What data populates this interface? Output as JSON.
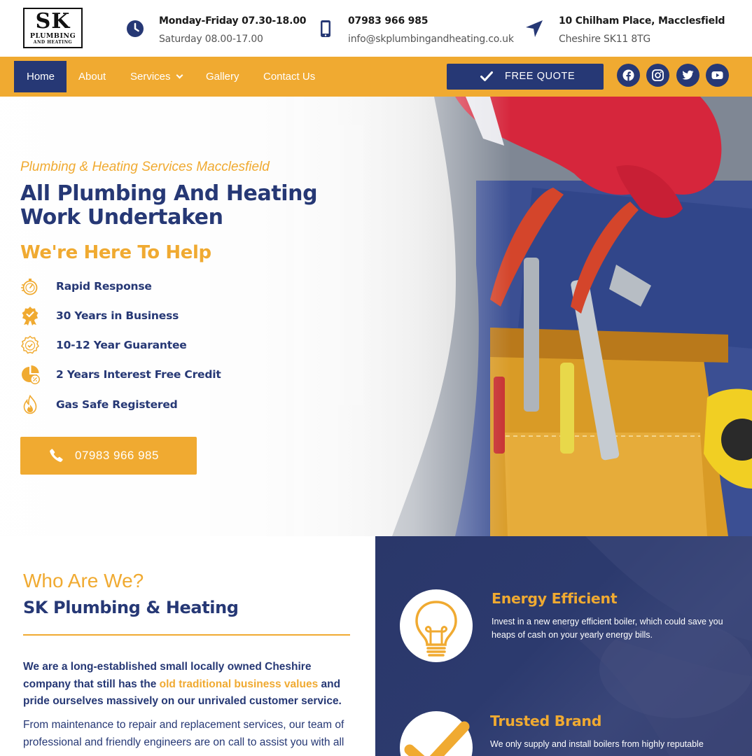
{
  "logo": {
    "mark": "SK",
    "line1": "PLUMBING",
    "line2": "AND HEATING"
  },
  "header": {
    "hours": {
      "line1": "Monday-Friday 07.30-18.00",
      "line2": "Saturday 08.00-17.00",
      "icon": "clock-icon"
    },
    "contact": {
      "line1": "07983 966 985",
      "line2": "info@skplumbingandheating.co.uk",
      "icon": "mobile-phone-icon"
    },
    "address": {
      "line1": "10 Chilham Place, Macclesfield",
      "line2": "Cheshire SK11 8TG",
      "icon": "location-arrow-icon"
    }
  },
  "nav": {
    "items": [
      {
        "label": "Home",
        "active": true
      },
      {
        "label": "About"
      },
      {
        "label": "Services",
        "has_dropdown": true
      },
      {
        "label": "Gallery"
      },
      {
        "label": "Contact Us"
      }
    ],
    "quote_button": "FREE QUOTE",
    "social": [
      "facebook-icon",
      "instagram-icon",
      "twitter-icon",
      "youtube-icon"
    ]
  },
  "hero": {
    "tagline": "Plumbing & Heating Services Macclesfield",
    "headline": "All Plumbing And Heating Work Undertaken",
    "subheadline": "We're Here To Help",
    "features": [
      {
        "label": "Rapid Response",
        "icon": "stopwatch-icon"
      },
      {
        "label": "30 Years in Business",
        "icon": "award-badge-icon"
      },
      {
        "label": "10-12 Year Guarantee",
        "icon": "guarantee-seal-icon"
      },
      {
        "label": "2 Years Interest Free Credit",
        "icon": "pie-chart-percent-icon"
      },
      {
        "label": "Gas Safe Registered",
        "icon": "flame-icon"
      }
    ],
    "call_button": "07983 966 985"
  },
  "about": {
    "title": "Who Are We?",
    "subtitle": "SK Plumbing & Heating",
    "intro_before": "We are a long-established small locally owned Cheshire company that still has the ",
    "intro_highlight": "old traditional business values",
    "intro_after": " and pride ourselves massively on our unrivaled customer service.",
    "body": "From maintenance to repair and replacement services, our team of professional and friendly engineers are on call to assist you with all"
  },
  "benefits": [
    {
      "title": "Energy Efficient",
      "text": "Invest in a new energy efficient boiler, which could save you heaps of cash on your yearly energy bills.",
      "icon": "lightbulb-icon"
    },
    {
      "title": "Trusted Brand",
      "text": "We only supply and install boilers from highly reputable",
      "icon": "checkmark-icon"
    }
  ],
  "colors": {
    "brand_navy": "#263875",
    "brand_orange": "#f0aa31",
    "panel_bg": "#2c3a6e"
  }
}
